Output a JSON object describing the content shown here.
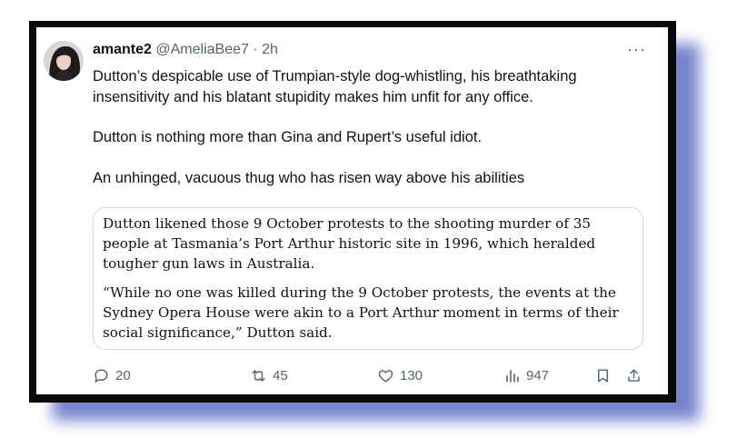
{
  "tweet": {
    "author_name": "amante2",
    "handle": "@AmeliaBee7",
    "separator": "·",
    "time": "2h",
    "more_label": "···",
    "paragraphs": [
      "Dutton’s despicable use of Trumpian-style dog-whistling, his breathtaking insensitivity and his blatant stupidity makes him unfit for any office.",
      "Dutton is nothing more than Gina and Rupert’s useful idiot.",
      "An unhinged, vacuous thug who has risen way above his abilities"
    ],
    "quote": {
      "paragraph_1": "Dutton likened those 9 October protests to the shooting murder of 35 people at Tasmania’s Port Arthur historic site in 1996, which heralded tougher gun laws in Australia.",
      "paragraph_2": "“While no one was killed during the 9 October protests, the events at the Sydney Opera House were akin to a Port Arthur moment in terms of their social significance,” Dutton said."
    },
    "actions": {
      "replies": "20",
      "retweets": "45",
      "likes": "130",
      "views": "947"
    }
  },
  "colors": {
    "frame": "#0a0a0a",
    "shadow": "#5f6fc4",
    "secondary_text": "#536471",
    "border": "#cfd9de"
  },
  "icons": [
    "reply-icon",
    "retweet-icon",
    "like-icon",
    "views-icon",
    "bookmark-icon",
    "share-icon",
    "more-icon"
  ]
}
